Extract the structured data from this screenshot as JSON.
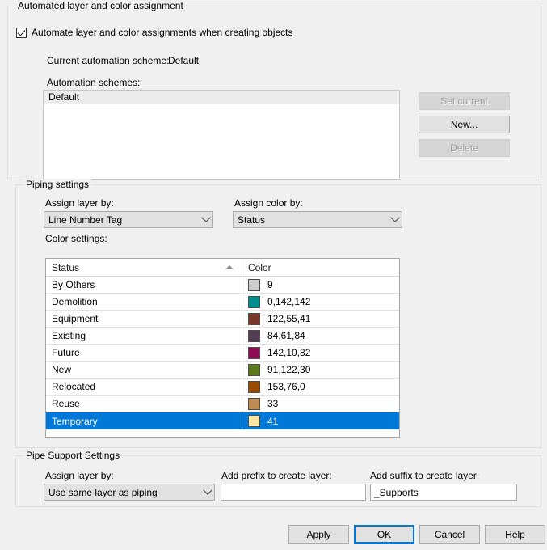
{
  "automation_group": {
    "title": "Automated layer and color assignment",
    "checkbox": {
      "label": "Automate layer and color assignments when creating objects",
      "checked": true
    },
    "current_scheme_label": "Current automation scheme:",
    "current_scheme_value": "Default",
    "schemes_label": "Automation schemes:",
    "schemes_list": [
      "Default"
    ],
    "buttons": {
      "set_current": "Set current",
      "new": "New...",
      "delete": "Delete"
    }
  },
  "piping_group": {
    "title": "Piping settings",
    "assign_layer_label": "Assign layer by:",
    "assign_layer_value": "Line Number Tag",
    "assign_color_label": "Assign color by:",
    "assign_color_value": "Status",
    "color_settings_label": "Color settings:",
    "grid": {
      "columns": [
        "Status",
        "Color"
      ],
      "sort_column": "Status",
      "sort_direction": "ascending",
      "rows": [
        {
          "status": "By Others",
          "color_value": "9",
          "swatch": "#cccccc",
          "selected": false
        },
        {
          "status": "Demolition",
          "color_value": "0,142,142",
          "swatch": "#008e8e",
          "selected": false
        },
        {
          "status": "Equipment",
          "color_value": "122,55,41",
          "swatch": "#7a3729",
          "selected": false
        },
        {
          "status": "Existing",
          "color_value": "84,61,84",
          "swatch": "#543d54",
          "selected": false
        },
        {
          "status": "Future",
          "color_value": "142,10,82",
          "swatch": "#8e0a52",
          "selected": false
        },
        {
          "status": "New",
          "color_value": "91,122,30",
          "swatch": "#5b7a1e",
          "selected": false
        },
        {
          "status": "Relocated",
          "color_value": "153,76,0",
          "swatch": "#994c00",
          "selected": false
        },
        {
          "status": "Reuse",
          "color_value": "33",
          "swatch": "#bd8a52",
          "selected": false
        },
        {
          "status": "Temporary",
          "color_value": "41",
          "swatch": "#ffe6a0",
          "selected": true
        }
      ]
    }
  },
  "pipe_support_group": {
    "title": "Pipe Support Settings",
    "assign_layer_label": "Assign layer by:",
    "assign_layer_value": "Use same layer as piping",
    "prefix_label": "Add prefix to create layer:",
    "prefix_value": "",
    "prefix_placeholder": "",
    "suffix_label": "Add suffix to create layer:",
    "suffix_value": "_Supports",
    "suffix_placeholder": ""
  },
  "dialog_buttons": {
    "apply": "Apply",
    "ok": "OK",
    "cancel": "Cancel",
    "help": "Help"
  },
  "theme": {
    "accent": "#0078d7",
    "dialog_bg": "#f0f0f0"
  }
}
